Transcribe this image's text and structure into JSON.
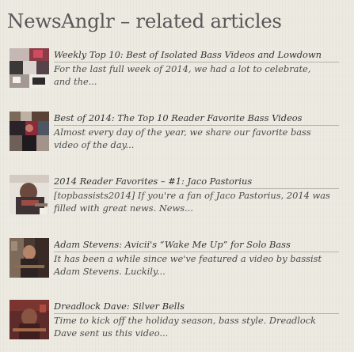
{
  "widget": {
    "title": "NewsAnglr – related articles"
  },
  "articles": [
    {
      "link": "Weekly Top 10: Best of Isolated Bass Videos and Lowdown",
      "excerpt": "For the last full week of 2014, we had a lot to celebrate,\nand the...",
      "thumb_icon": "bass-videos-collage-thumbnail-icon"
    },
    {
      "link": "Best of 2014: The Top 10 Reader Favorite Bass Videos",
      "excerpt": "Almost every day of the year, we share our favorite bass\nvideo of the day...",
      "thumb_icon": "reader-favorites-collage-thumbnail-icon"
    },
    {
      "link": "2014 Reader Favorites – #1: Jaco Pastorius",
      "excerpt": "[topbassists2014] If you're a fan of Jaco Pastorius, 2014 was\nfilled with great news. News...",
      "thumb_icon": "jaco-pastorius-thumbnail-icon"
    },
    {
      "link": "Adam Stevens: Avicii's “Wake Me Up” for Solo Bass",
      "excerpt": "It has been a while since we've featured a video by bassist\nAdam Stevens. Luckily...",
      "thumb_icon": "adam-stevens-thumbnail-icon"
    },
    {
      "link": "Dreadlock Dave: Silver Bells",
      "excerpt": "Time to kick off the holiday season, bass style. Dreadlock\nDave sent us this video...",
      "thumb_icon": "dreadlock-dave-thumbnail-icon"
    }
  ]
}
